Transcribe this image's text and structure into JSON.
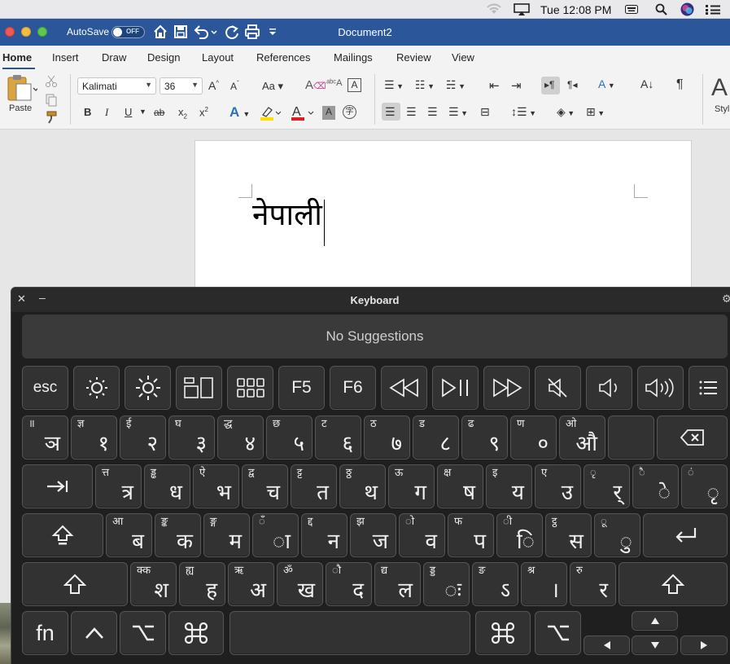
{
  "menubar": {
    "clock": "Tue 12:08 PM"
  },
  "titlebar": {
    "autosave_label": "AutoSave",
    "autosave_state": "OFF",
    "document_title": "Document2"
  },
  "ribbon": {
    "tabs": [
      "Home",
      "Insert",
      "Draw",
      "Design",
      "Layout",
      "References",
      "Mailings",
      "Review",
      "View"
    ],
    "active_tab": "Home",
    "paste_label": "Paste",
    "font_name": "Kalimati",
    "font_size": "36",
    "styles_label": "Styl",
    "bold": "B",
    "italic": "I",
    "underline": "U",
    "strike": "ab",
    "subscript": "x",
    "superscript": "x"
  },
  "document": {
    "text": "नेपाली"
  },
  "keyboard": {
    "title": "Keyboard",
    "suggestions": "No Suggestions",
    "fn_row": [
      "esc",
      "F5",
      "F6"
    ],
    "row1": [
      {
        "alt": "॥",
        "main": "ञ"
      },
      {
        "alt": "ज्ञ",
        "main": "१"
      },
      {
        "alt": "ई",
        "main": "२"
      },
      {
        "alt": "घ",
        "main": "३"
      },
      {
        "alt": "द्ध",
        "main": "४"
      },
      {
        "alt": "छ",
        "main": "५"
      },
      {
        "alt": "ट",
        "main": "६"
      },
      {
        "alt": "ठ",
        "main": "७"
      },
      {
        "alt": "ड",
        "main": "८"
      },
      {
        "alt": "ढ",
        "main": "९"
      },
      {
        "alt": "ण",
        "main": "०"
      },
      {
        "alt": "ओ",
        "main": "औ"
      },
      {
        "alt": "",
        "main": ""
      }
    ],
    "row2": [
      {
        "alt": "त्त",
        "main": "त्र"
      },
      {
        "alt": "ड्ढ",
        "main": "ध"
      },
      {
        "alt": "ऐ",
        "main": "भ"
      },
      {
        "alt": "द्व",
        "main": "च"
      },
      {
        "alt": "ट्ट",
        "main": "त"
      },
      {
        "alt": "ठ्ठ",
        "main": "थ"
      },
      {
        "alt": "ऊ",
        "main": "ग"
      },
      {
        "alt": "क्ष",
        "main": "ष"
      },
      {
        "alt": "इ",
        "main": "य"
      },
      {
        "alt": "ए",
        "main": "उ"
      },
      {
        "alt": "ृ",
        "main": "र्"
      },
      {
        "alt": "ै",
        "main": "े"
      },
      {
        "alt": "ं",
        "main": "ृ"
      }
    ],
    "row3": [
      {
        "alt": "आ",
        "main": "ब"
      },
      {
        "alt": "ङ्क",
        "main": "क"
      },
      {
        "alt": "ङ्ग",
        "main": "म"
      },
      {
        "alt": "ँ",
        "main": "ा"
      },
      {
        "alt": "द्द",
        "main": "न"
      },
      {
        "alt": "झ",
        "main": "ज"
      },
      {
        "alt": "ो",
        "main": "व"
      },
      {
        "alt": "फ",
        "main": "प"
      },
      {
        "alt": "ी",
        "main": "ि"
      },
      {
        "alt": "ट्ठ",
        "main": "स"
      },
      {
        "alt": "ू",
        "main": "ु"
      }
    ],
    "row4": [
      {
        "alt": "क्क",
        "main": "श"
      },
      {
        "alt": "ह्य",
        "main": "ह"
      },
      {
        "alt": "ऋ",
        "main": "अ"
      },
      {
        "alt": "ॐ",
        "main": "ख"
      },
      {
        "alt": "ौ",
        "main": "द"
      },
      {
        "alt": "द्य",
        "main": "ल"
      },
      {
        "alt": "ड्ड",
        "main": "ः"
      },
      {
        "alt": "ङ",
        "main": "ऽ"
      },
      {
        "alt": "श्र",
        "main": "।"
      },
      {
        "alt": "रु",
        "main": "र"
      }
    ],
    "bottom": {
      "fn": "fn"
    }
  }
}
